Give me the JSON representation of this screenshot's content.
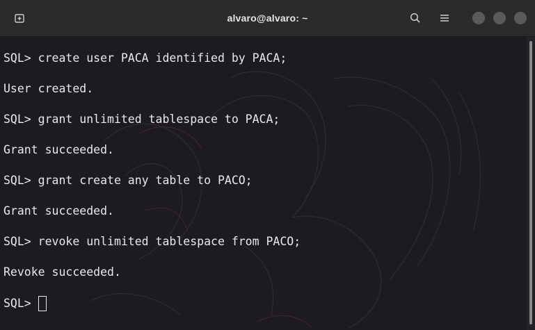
{
  "window": {
    "title": "alvaro@alvaro: ~"
  },
  "icons": {
    "new_tab": "new-tab-icon",
    "search": "search-icon",
    "menu": "hamburger-menu-icon",
    "minimize": "minimize-icon",
    "maximize": "maximize-icon",
    "close": "close-icon"
  },
  "colors": {
    "titlebar": "#2b2b2b",
    "terminal_bg": "#1d1a21",
    "text": "#e9e9e9",
    "window_control": "#5a5a5a"
  },
  "terminal": {
    "lines": [
      "SQL> create user PACA identified by PACA;",
      "User created.",
      "SQL> grant unlimited tablespace to PACA;",
      "Grant succeeded.",
      "SQL> grant create any table to PACO;",
      "Grant succeeded.",
      "SQL> revoke unlimited tablespace from PACO;",
      "Revoke succeeded."
    ],
    "prompt": "SQL>"
  }
}
